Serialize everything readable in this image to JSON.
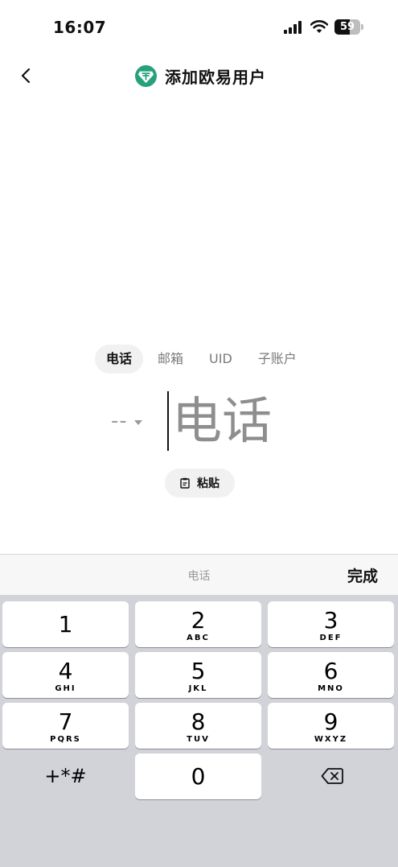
{
  "status_bar": {
    "time": "16:07",
    "battery": "59",
    "battery_level": 0.59
  },
  "header": {
    "title": "添加欧易用户",
    "logo_color": "#26a17b"
  },
  "tabs": [
    {
      "label": "电话",
      "active": true
    },
    {
      "label": "邮箱",
      "active": false
    },
    {
      "label": "UID",
      "active": false
    },
    {
      "label": "子账户",
      "active": false
    }
  ],
  "phone": {
    "country_code": "--",
    "placeholder": "电话"
  },
  "paste": {
    "label": "粘贴"
  },
  "keyboard": {
    "field_label": "电话",
    "done_label": "完成",
    "keys": [
      {
        "digit": "1",
        "letters": ""
      },
      {
        "digit": "2",
        "letters": "ABC"
      },
      {
        "digit": "3",
        "letters": "DEF"
      },
      {
        "digit": "4",
        "letters": "GHI"
      },
      {
        "digit": "5",
        "letters": "JKL"
      },
      {
        "digit": "6",
        "letters": "MNO"
      },
      {
        "digit": "7",
        "letters": "PQRS"
      },
      {
        "digit": "8",
        "letters": "TUV"
      },
      {
        "digit": "9",
        "letters": "WXYZ"
      }
    ],
    "symbols_label": "+*#",
    "zero": "0",
    "delete_icon": "backspace-icon"
  },
  "colors": {
    "keyboard_bg": "#d1d3d9",
    "tab_active_bg": "#f1f1f1",
    "placeholder": "#8e8e8e"
  }
}
